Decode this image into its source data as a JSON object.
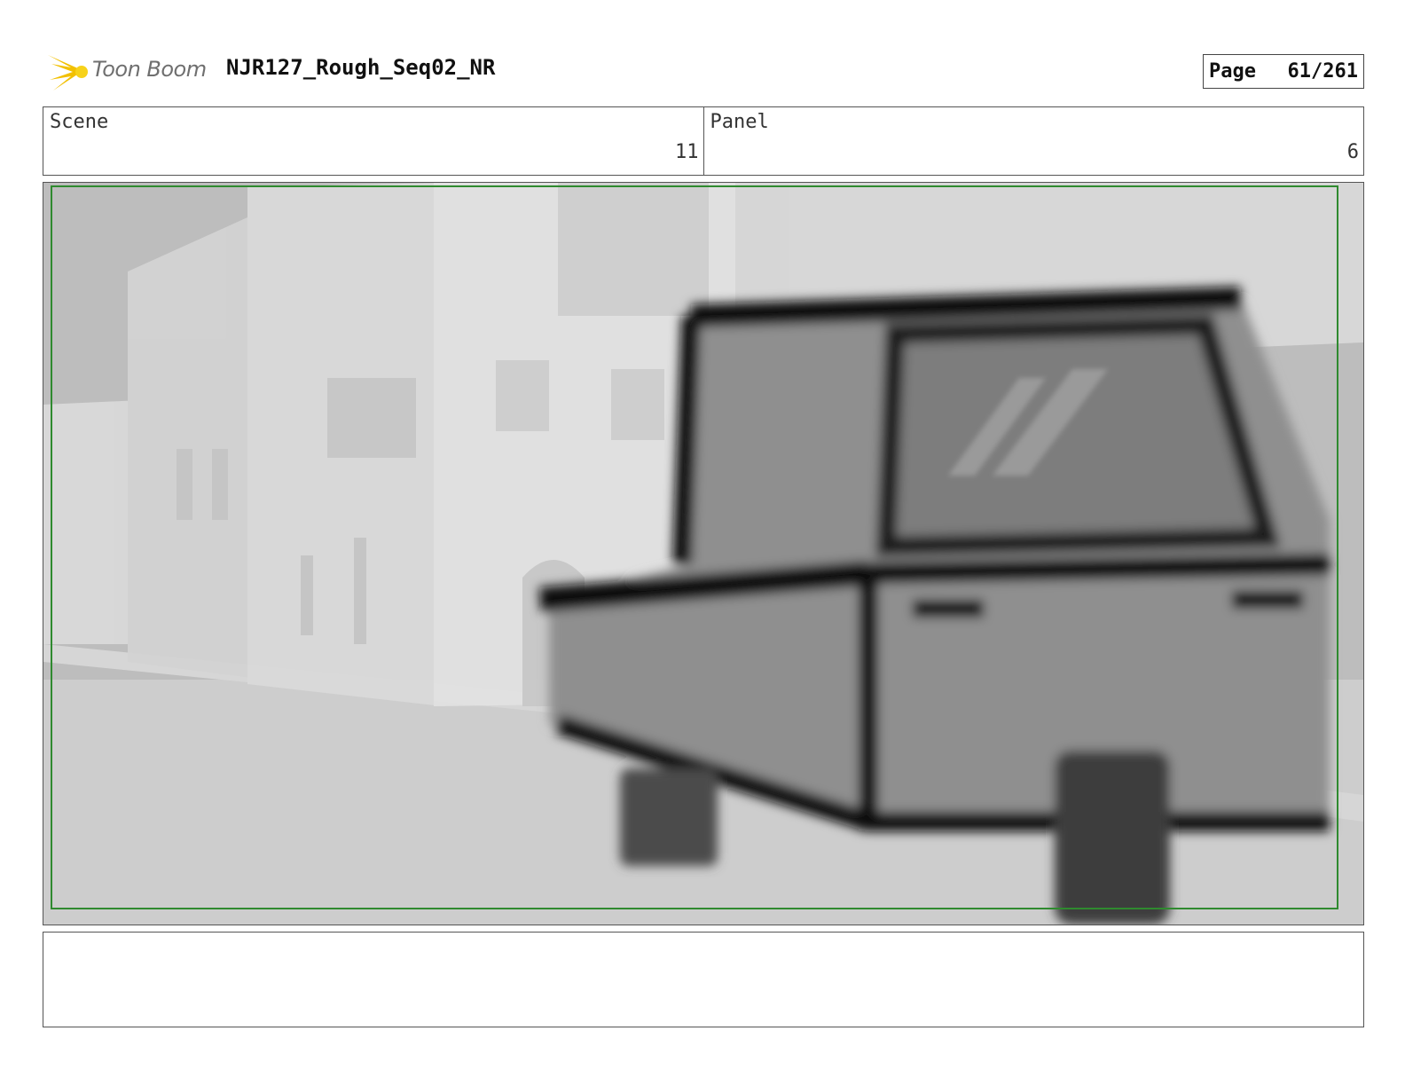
{
  "header": {
    "logo_text": "Toon Boom",
    "title": "NJR127_Rough_Seq02_NR",
    "page_label": "Page",
    "page_number": "61/261"
  },
  "info": {
    "scene_label": "Scene",
    "scene_value": "11",
    "panel_label": "Panel",
    "panel_value": "6"
  },
  "notes": {
    "text": ""
  },
  "colors": {
    "logo_accent": "#f2c000",
    "safe_frame": "#2f8a2f"
  }
}
